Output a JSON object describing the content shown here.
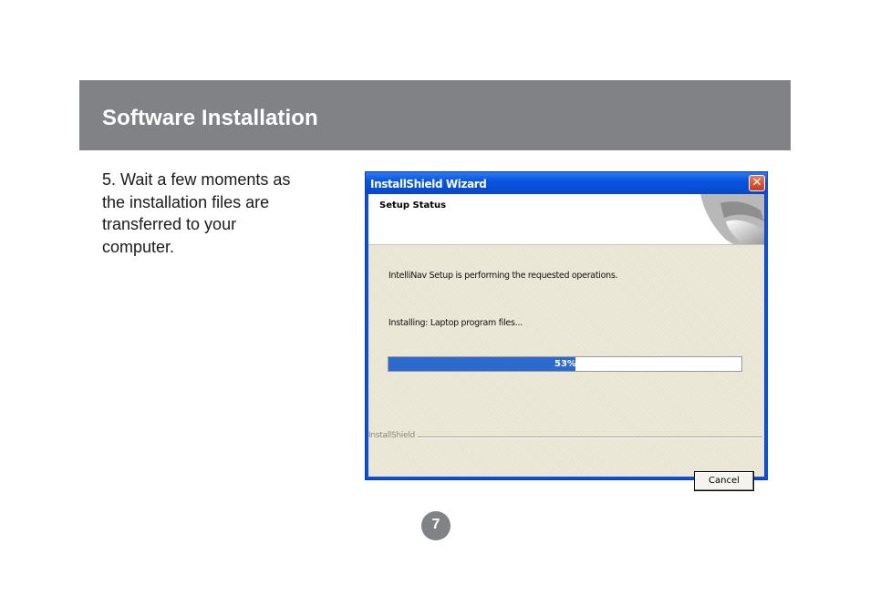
{
  "header": {
    "title": "Software Installation"
  },
  "instruction": {
    "text": "5. Wait a few moments as the installation files are transferred to your computer."
  },
  "dialog": {
    "title": "InstallShield Wizard",
    "close_label": "✕",
    "banner_title": "Setup Status",
    "status_text": "IntelliNav Setup is performing the requested operations.",
    "installing_text": "Installing: Laptop program files...",
    "progress": {
      "percent": 53,
      "label": "53%"
    },
    "brand_label": "InstallShield",
    "cancel_label": "Cancel"
  },
  "page": {
    "number": "7"
  },
  "colors": {
    "header_bg": "#808285",
    "titlebar": "#0a55e0",
    "progress_fill": "#2d6ad0"
  }
}
